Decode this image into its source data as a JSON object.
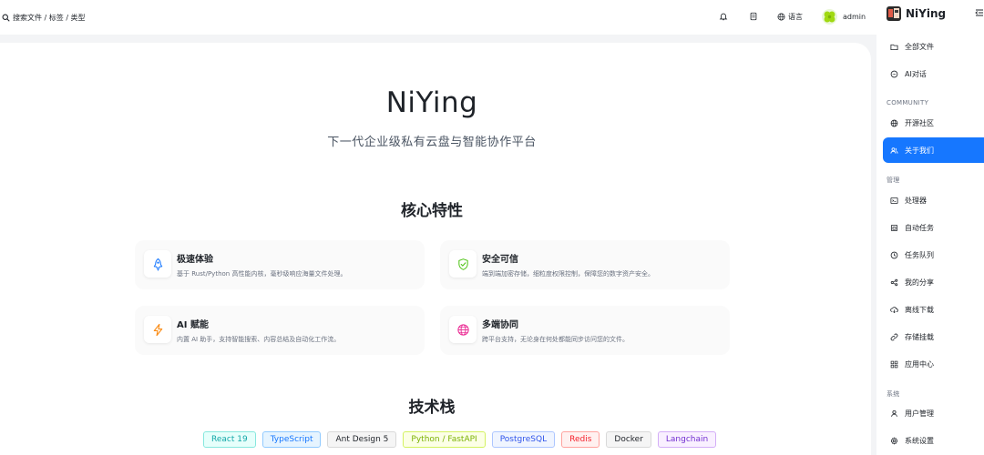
{
  "header": {
    "search_placeholder": "搜索文件 / 标签 / 类型",
    "language_label": "语言",
    "user_name": "admin"
  },
  "sidebar": {
    "brand": "NiYing",
    "groups": {
      "community": "COMMUNITY",
      "manage": "管理",
      "system": "系统"
    },
    "items": [
      {
        "label": "全部文件",
        "icon": "folder-icon"
      },
      {
        "label": "AI对话",
        "icon": "chat-icon"
      },
      {
        "label": "开源社区",
        "icon": "globe-icon"
      },
      {
        "label": "关于我们",
        "icon": "users-icon",
        "active": true
      },
      {
        "label": "处理器",
        "icon": "terminal-icon"
      },
      {
        "label": "自动任务",
        "icon": "calendar-icon"
      },
      {
        "label": "任务队列",
        "icon": "clock-icon"
      },
      {
        "label": "我的分享",
        "icon": "share-icon"
      },
      {
        "label": "离线下载",
        "icon": "cloud-download-icon"
      },
      {
        "label": "存储挂载",
        "icon": "link-icon"
      },
      {
        "label": "应用中心",
        "icon": "grid-icon"
      },
      {
        "label": "用户管理",
        "icon": "user-icon"
      },
      {
        "label": "系统设置",
        "icon": "gear-icon"
      }
    ]
  },
  "main": {
    "title": "NiYing",
    "subtitle": "下一代企业级私有云盘与智能协作平台",
    "features_title": "核心特性",
    "features": [
      {
        "title": "极速体验",
        "desc": "基于 Rust/Python 高性能内核，毫秒级响应海量文件处理。",
        "icon": "rocket-icon"
      },
      {
        "title": "安全可信",
        "desc": "端到端加密存储，细粒度权限控制，保障您的数字资产安全。",
        "icon": "shield-check-icon"
      },
      {
        "title": "AI 赋能",
        "desc": "内置 AI 助手，支持智能搜索、内容总结及自动化工作流。",
        "icon": "lightning-icon"
      },
      {
        "title": "多端协同",
        "desc": "跨平台支持，无论身在何处都能同步访问您的文件。",
        "icon": "globe-icon"
      }
    ],
    "tech_title": "技术栈",
    "tech": [
      {
        "label": "React 19",
        "color": "#13a8a8",
        "bg": "#e6fffb",
        "border": "#87e8de"
      },
      {
        "label": "TypeScript",
        "color": "#1677ff",
        "bg": "#e6f4ff",
        "border": "#91caff"
      },
      {
        "label": "Ant Design 5",
        "color": "#1f2329",
        "bg": "#f5f5f5",
        "border": "#d9d9d9"
      },
      {
        "label": "Python / FastAPI",
        "color": "#7cb305",
        "bg": "#fcffe6",
        "border": "#d3f261"
      },
      {
        "label": "PostgreSQL",
        "color": "#2f54eb",
        "bg": "#f0f5ff",
        "border": "#adc6ff"
      },
      {
        "label": "Redis",
        "color": "#f5222d",
        "bg": "#fff1f0",
        "border": "#ffa39e"
      },
      {
        "label": "Docker",
        "color": "#1f2329",
        "bg": "#f5f5f5",
        "border": "#d9d9d9"
      },
      {
        "label": "Langchain",
        "color": "#722ed1",
        "bg": "#f9f0ff",
        "border": "#d3adf7"
      }
    ]
  },
  "colors": {
    "accent": "#1677ff",
    "rocket": "#1677ff",
    "shield": "#52c41a",
    "lightning": "#fa8c16",
    "globe": "#eb2f96"
  }
}
